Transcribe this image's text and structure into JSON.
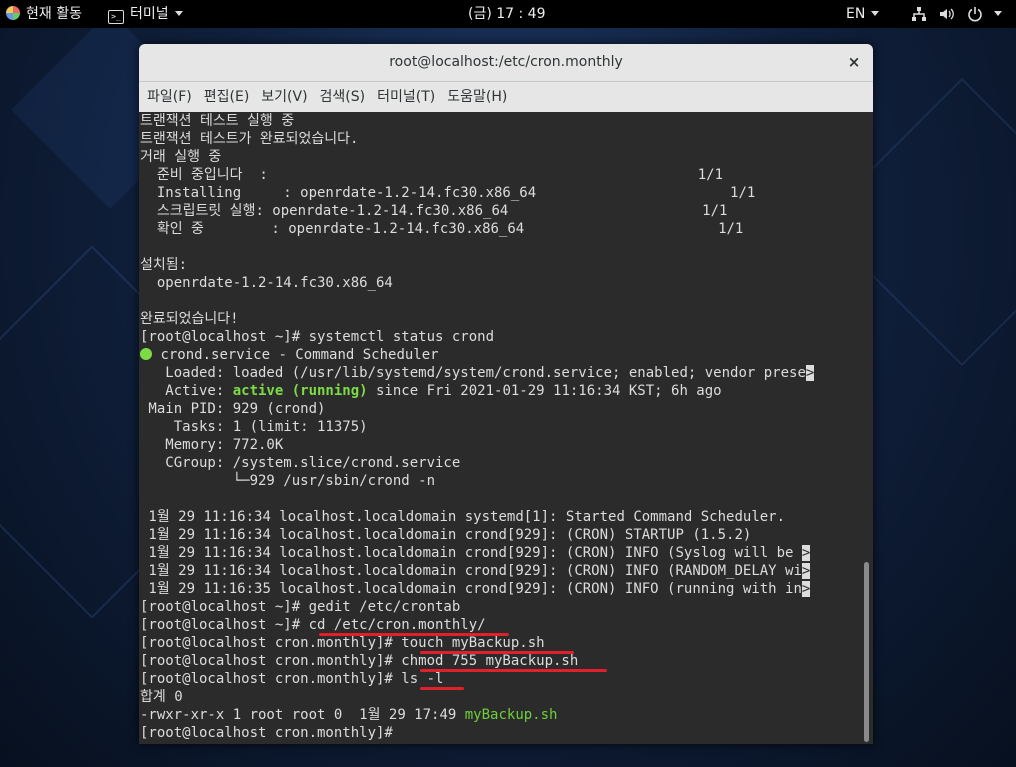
{
  "topbar": {
    "activities": "현재 활동",
    "app_menu": "터미널",
    "clock": "(금) 17 : 49",
    "lang": "EN"
  },
  "window": {
    "title": "root@localhost:/etc/cron.monthly",
    "close": "×"
  },
  "menu": [
    "파일(F)",
    "편집(E)",
    "보기(V)",
    "검색(S)",
    "터미널(T)",
    "도움말(H)"
  ],
  "terminal": {
    "lines": [
      "트랜잭션 테스트 실행 중",
      "트랜잭션 테스트가 완료되었습니다.",
      "거래 실행 중",
      "  준비 중입니다  :                                                   1/1",
      "  Installing     : openrdate-1.2-14.fc30.x86_64                       1/1",
      "  스크립트릿 실행: openrdate-1.2-14.fc30.x86_64                       1/1",
      "  확인 중        : openrdate-1.2-14.fc30.x86_64                       1/1",
      "",
      "설치됨:",
      "  openrdate-1.2-14.fc30.x86_64",
      "",
      "완료되었습니다!",
      "[root@localhost ~]# systemctl status crond"
    ],
    "service_line": "crond.service - Command Scheduler",
    "loaded": "   Loaded: loaded (/usr/lib/systemd/system/crond.service; enabled; vendor prese",
    "active_pre": "   Active: ",
    "active_state": "active (running)",
    "active_post": " since Fri 2021-01-29 11:16:34 KST; 6h ago",
    "status_lines": [
      " Main PID: 929 (crond)",
      "    Tasks: 1 (limit: 11375)",
      "   Memory: 772.0K",
      "   CGroup: /system.slice/crond.service",
      "           └─929 /usr/sbin/crond -n",
      ""
    ],
    "log_lines": [
      " 1월 29 11:16:34 localhost.localdomain systemd[1]: Started Command Scheduler.",
      " 1월 29 11:16:34 localhost.localdomain crond[929]: (CRON) STARTUP (1.5.2)",
      " 1월 29 11:16:34 localhost.localdomain crond[929]: (CRON) INFO (Syslog will be ",
      " 1월 29 11:16:34 localhost.localdomain crond[929]: (CRON) INFO (RANDOM_DELAY wi",
      " 1월 29 11:16:35 localhost.localdomain crond[929]: (CRON) INFO (running with in"
    ],
    "cmd_lines": [
      "[root@localhost ~]# gedit /etc/crontab",
      "[root@localhost ~]# cd /etc/cron.monthly/",
      "[root@localhost cron.monthly]# touch myBackup.sh",
      "[root@localhost cron.monthly]# chmod 755 myBackup.sh",
      "[root@localhost cron.monthly]# ls -l",
      "합계 0"
    ],
    "ls_prefix": "-rwxr-xr-x 1 root root 0  1월 29 17:49 ",
    "ls_file": "myBackup.sh",
    "prompt": "[root@localhost cron.monthly]#",
    "trunc_marker": ">"
  },
  "colors": {
    "highlight_underline": "#e0202a",
    "exec_file": "#6fcf3c"
  }
}
